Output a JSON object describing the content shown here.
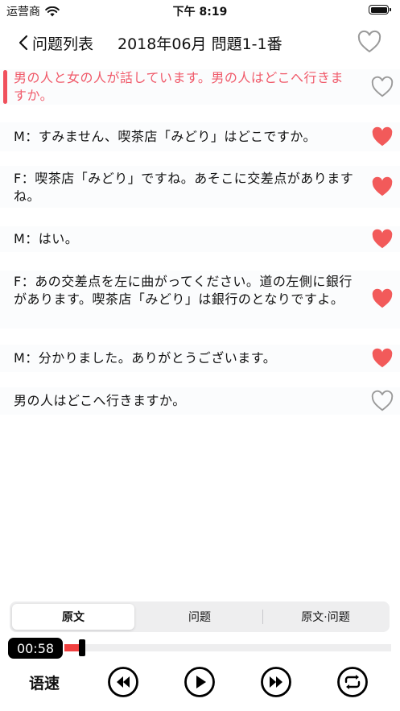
{
  "status_bar": {
    "carrier": "运营商",
    "time": "下午 8:19"
  },
  "navbar": {
    "back_label": "问题列表",
    "title": "2018年06月 問題1-1番"
  },
  "dialogue": [
    {
      "text": "男の人と女の人が話しています。男の人はどこへ行きますか。",
      "active": true,
      "favorite": false
    },
    {
      "text": "M：すみません、喫茶店「みどり」はどこですか。",
      "active": false,
      "favorite": true
    },
    {
      "text": "F：喫茶店「みどり」ですね。あそこに交差点がありますね。",
      "active": false,
      "favorite": true
    },
    {
      "text": "M：はい。",
      "active": false,
      "favorite": true
    },
    {
      "text": "F：あの交差点を左に曲がってください。道の左側に銀行があります。喫茶店「みどり」は銀行のとなりですよ。",
      "active": false,
      "favorite": true
    },
    {
      "text": "M：分かりました。ありがとうございます。",
      "active": false,
      "favorite": true
    },
    {
      "text": "男の人はどこへ行きますか。",
      "active": false,
      "favorite": false
    }
  ],
  "segment": {
    "options": [
      "原文",
      "问题",
      "原文·问题"
    ],
    "selected": 0
  },
  "player": {
    "elapsed": "00:58",
    "progress": 0.045,
    "speed_label": "语速"
  },
  "colors": {
    "accent": "#f05a6a",
    "heart_filled": "#f25a5a",
    "heart_outline": "#9a9a9a"
  }
}
